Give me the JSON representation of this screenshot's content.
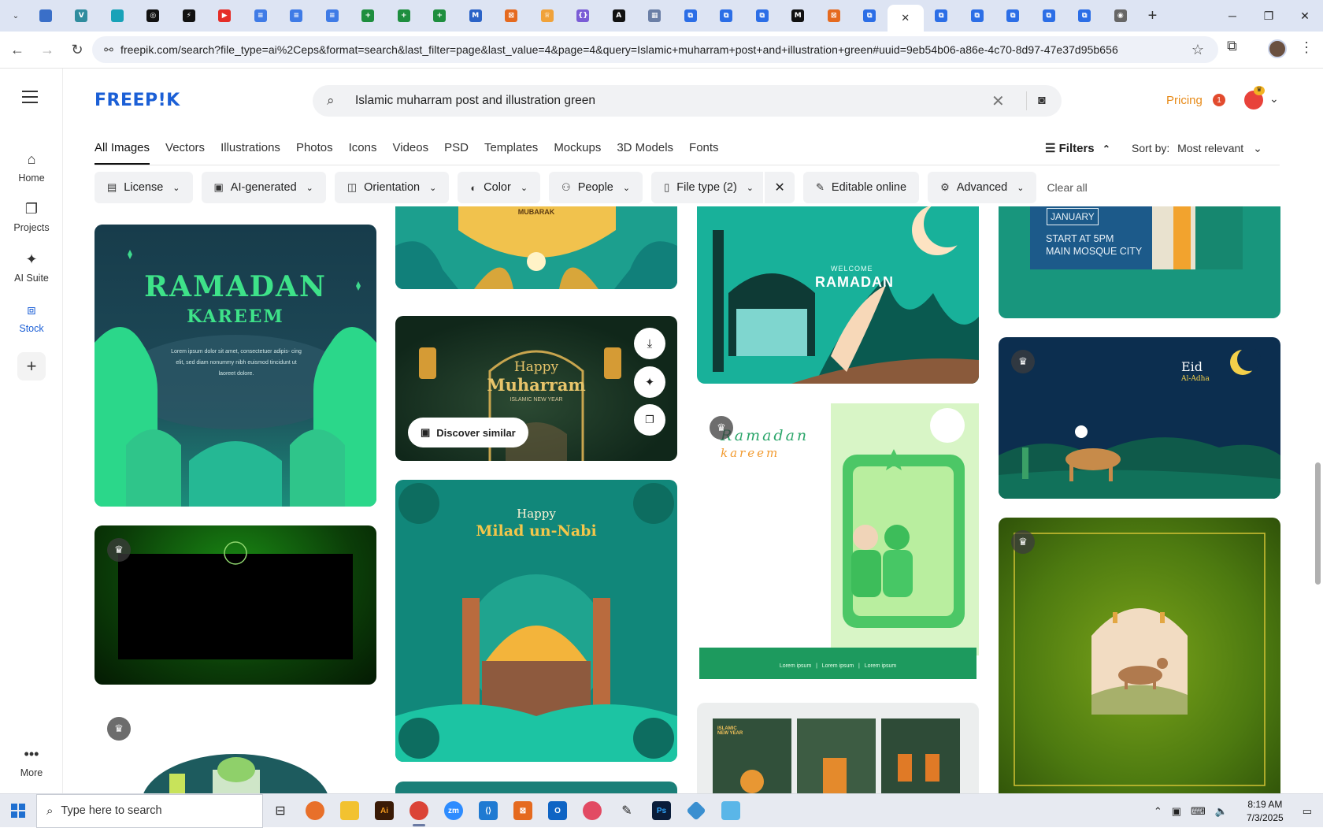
{
  "browser": {
    "tabs": [
      {
        "icon": "tab-list-icon",
        "color": "#333333",
        "glyph": ""
      },
      {
        "icon": "globe-tab-icon",
        "color": "#3a6fc8",
        "glyph": ""
      },
      {
        "icon": "vpn-tab-icon",
        "color": "#2f8c9e",
        "glyph": "V"
      },
      {
        "icon": "tech-tab-icon",
        "color": "#18a2b8",
        "glyph": ""
      },
      {
        "icon": "openai-tab-icon",
        "color": "#111111",
        "glyph": "◎"
      },
      {
        "icon": "lightning-tab-icon",
        "color": "#111111",
        "glyph": "⚡"
      },
      {
        "icon": "youtube-tab-icon",
        "color": "#e52d27",
        "glyph": "▶"
      },
      {
        "icon": "docs-tab-icon",
        "color": "#3f7be6",
        "glyph": "≡"
      },
      {
        "icon": "docs-tab-icon",
        "color": "#3f7be6",
        "glyph": "≡"
      },
      {
        "icon": "docs-tab-icon",
        "color": "#3f7be6",
        "glyph": "≡"
      },
      {
        "icon": "sheets-tab-icon",
        "color": "#1e8e3e",
        "glyph": "+"
      },
      {
        "icon": "sheets-tab-icon",
        "color": "#1e8e3e",
        "glyph": "+"
      },
      {
        "icon": "sheets-tab-icon",
        "color": "#1e8e3e",
        "glyph": "+"
      },
      {
        "icon": "word-tab-icon",
        "color": "#2b63c7",
        "glyph": "M"
      },
      {
        "icon": "grid-tab-icon",
        "color": "#e56a1f",
        "glyph": "⊠"
      },
      {
        "icon": "crown-tab-icon",
        "color": "#f0a23a",
        "glyph": "♕"
      },
      {
        "icon": "code-tab-icon",
        "color": "#7a5cd6",
        "glyph": "{}"
      },
      {
        "icon": "ai-tab-icon",
        "color": "#111111",
        "glyph": "A"
      },
      {
        "icon": "pixel-tab-icon",
        "color": "#6b7fa6",
        "glyph": "▦"
      },
      {
        "icon": "forms-tab-icon",
        "color": "#2c6ee6",
        "glyph": "⧉"
      },
      {
        "icon": "forms-tab-icon",
        "color": "#2c6ee6",
        "glyph": "⧉"
      },
      {
        "icon": "forms-tab-icon",
        "color": "#2c6ee6",
        "glyph": "⧉"
      },
      {
        "icon": "medium-tab-icon",
        "color": "#111111",
        "glyph": "M"
      },
      {
        "icon": "grid-tab-icon",
        "color": "#e56a1f",
        "glyph": "⊠"
      },
      {
        "icon": "forms-tab-icon",
        "color": "#2c6ee6",
        "glyph": "⧉"
      },
      {
        "icon": "close-tab-icon",
        "color": "#333333",
        "glyph": "✕"
      },
      {
        "icon": "forms-tab-icon",
        "color": "#2c6ee6",
        "glyph": "⧉"
      },
      {
        "icon": "forms-tab-icon",
        "color": "#2c6ee6",
        "glyph": "⧉"
      },
      {
        "icon": "forms-tab-icon",
        "color": "#2c6ee6",
        "glyph": "⧉"
      },
      {
        "icon": "forms-tab-icon",
        "color": "#2c6ee6",
        "glyph": "⧉"
      },
      {
        "icon": "forms-tab-icon",
        "color": "#2c6ee6",
        "glyph": "⧉"
      },
      {
        "icon": "chrome-tab-icon",
        "color": "#666666",
        "glyph": "◉"
      }
    ],
    "url": "freepik.com/search?file_type=ai%2Ceps&format=search&last_filter=page&last_value=4&page=4&query=Islamic+muharram+post+and+illustration+green#uuid=9eb54b06-a86e-4c70-8d97-47e37d95b656"
  },
  "sidebar": {
    "items": [
      {
        "label": "Home",
        "icon": "home-icon",
        "glyph": "⌂"
      },
      {
        "label": "Projects",
        "icon": "projects-icon",
        "glyph": "❐"
      },
      {
        "label": "AI Suite",
        "icon": "ai-suite-icon",
        "glyph": "✦"
      },
      {
        "label": "Stock",
        "icon": "stock-icon",
        "glyph": "⧈"
      }
    ],
    "more_label": "More"
  },
  "header": {
    "logo": "FREEP!K",
    "search_query": "Islamic muharram post and illustration green",
    "pricing": "Pricing",
    "notifications": "1"
  },
  "categories": [
    "All Images",
    "Vectors",
    "Illustrations",
    "Photos",
    "Icons",
    "Videos",
    "PSD",
    "Templates",
    "Mockups",
    "3D Models",
    "Fonts"
  ],
  "filters": {
    "label": "Filters",
    "sort_label": "Sort by:",
    "sort_value": "Most relevant",
    "chips": [
      {
        "label": "License",
        "icon": "license-icon",
        "glyph": "▤"
      },
      {
        "label": "AI-generated",
        "icon": "ai-generated-icon",
        "glyph": "▣"
      },
      {
        "label": "Orientation",
        "icon": "orientation-icon",
        "glyph": "◫"
      },
      {
        "label": "Color",
        "icon": "palette-icon",
        "glyph": "◐"
      },
      {
        "label": "People",
        "icon": "people-icon",
        "glyph": "⚇"
      },
      {
        "label": "File type (2)",
        "icon": "file-icon",
        "glyph": "▯"
      },
      {
        "label": "Editable online",
        "icon": "pen-icon",
        "glyph": "✎"
      },
      {
        "label": "Advanced",
        "icon": "settings-icon",
        "glyph": "⚙"
      }
    ],
    "clear_all": "Clear all"
  },
  "results": {
    "card_a": {
      "title": "RAMADAN",
      "subtitle": "KAREEM",
      "body": "Lorem ipsum dolor sit amet, consectetuer adipis- cing elit, sed diam nonummy nibh euismod tincidunt ut laoreet dolore."
    },
    "card_b": {
      "top_text": "MUBARAK"
    },
    "card_c": {
      "line1": "Happy",
      "line2": "Muharram",
      "line3": "ISLAMIC NEW YEAR",
      "discover": "Discover similar"
    },
    "card_d": {
      "line1": "Happy",
      "line2": "Milad un-Nabi"
    },
    "card_e": {
      "line1": "WELCOME",
      "line2": "RAMADAN"
    },
    "card_f": {
      "title": "Ramadan",
      "subtitle": "kareem",
      "footer": "Lorem ipsum   |   Lorem ipsum   |   Lorem ipsum"
    },
    "card_g": {
      "line1": "JANUARY",
      "line2": "START AT 5PM",
      "line3": "MAIN MOSQUE CITY"
    },
    "card_h": {
      "line1": "Eid",
      "line2": "Al-Adha"
    },
    "card_i": {
      "label": "ISLAMIC NEW YEAR"
    }
  },
  "taskbar": {
    "search_placeholder": "Type here to search",
    "time": "8:19 AM",
    "date": "7/3/2025"
  },
  "colors": {
    "brand": "#1b5fd6",
    "pricing": "#e78a18",
    "active_sidebar": "#1b5fd6"
  }
}
